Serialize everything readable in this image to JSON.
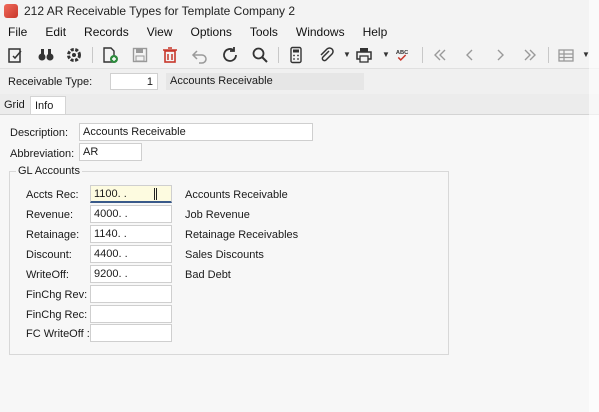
{
  "window": {
    "title": "212 AR Receivable Types for Template Company 2"
  },
  "menu": [
    "File",
    "Edit",
    "Records",
    "View",
    "Options",
    "Tools",
    "Windows",
    "Help"
  ],
  "toolbar_icons": [
    "edit-icon",
    "binoculars-icon",
    "gear-icon",
    "add-document-icon",
    "save-icon",
    "delete-icon",
    "undo-icon",
    "refresh-icon",
    "search-icon",
    "calculator-icon",
    "attach-icon",
    "print-icon",
    "spellcheck-icon",
    "first-record-icon",
    "previous-record-icon",
    "next-record-icon",
    "last-record-icon",
    "grid-view-icon"
  ],
  "toolbar": {
    "spellcheck_text": "ABC"
  },
  "header": {
    "receivable_type_label": "Receivable Type:",
    "receivable_type_value": "1",
    "receivable_type_desc": "Accounts Receivable"
  },
  "tabs": [
    "Grid",
    "Info"
  ],
  "info": {
    "description_label": "Description:",
    "description_value": "Accounts Receivable",
    "abbreviation_label": "Abbreviation:",
    "abbreviation_value": "AR",
    "group_title": "GL Accounts",
    "gl": [
      {
        "label": "Accts Rec:",
        "value": "1100.  .",
        "desc": "Accounts Receivable"
      },
      {
        "label": "Revenue:",
        "value": "4000.  .",
        "desc": "Job Revenue"
      },
      {
        "label": "Retainage:",
        "value": "1140.  .",
        "desc": "Retainage Receivables"
      },
      {
        "label": "Discount:",
        "value": "4400.  .",
        "desc": "Sales Discounts"
      },
      {
        "label": "WriteOff:",
        "value": "9200.  .",
        "desc": "Bad Debt"
      },
      {
        "label": "FinChg Rev:",
        "value": "",
        "desc": ""
      },
      {
        "label": "FinChg Rec:",
        "value": "",
        "desc": ""
      },
      {
        "label": "FC WriteOff :",
        "value": "",
        "desc": ""
      }
    ]
  },
  "colors": {
    "active_field_bg": "#fdfbe0",
    "delete_red": "#c8372b",
    "spellcheck_red": "#c8372b"
  }
}
